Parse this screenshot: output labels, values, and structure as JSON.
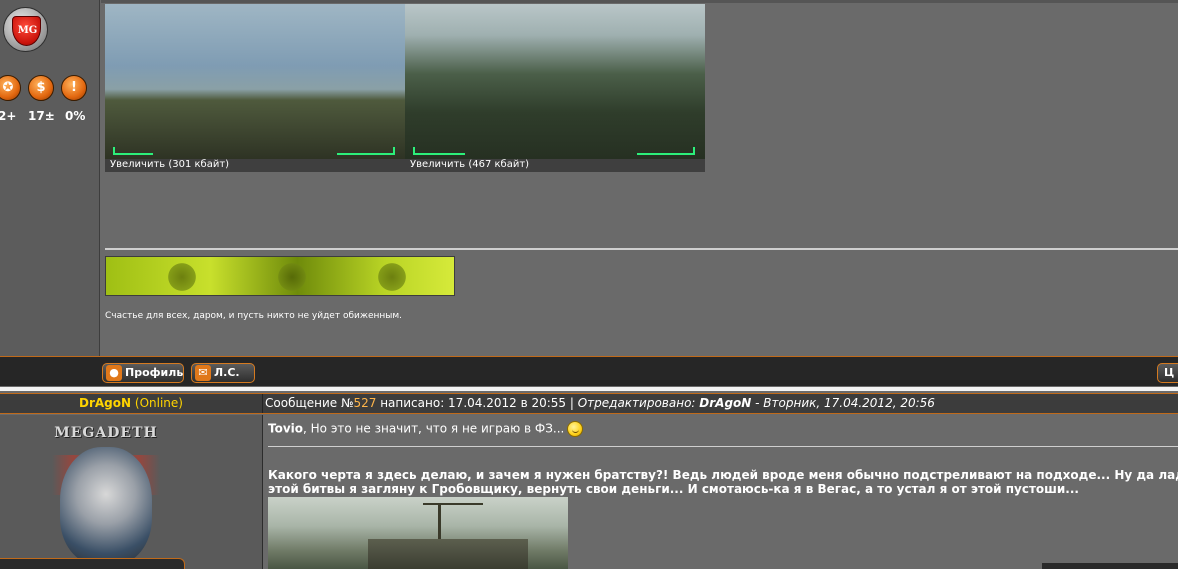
{
  "upper_post": {
    "logo_text": "MG",
    "stats": [
      {
        "icon": "award-icon",
        "glyph": "✪",
        "value": "2+"
      },
      {
        "icon": "rating-icon",
        "glyph": "$",
        "value": "17±"
      },
      {
        "icon": "warning-icon",
        "glyph": "!",
        "value": "0%"
      }
    ],
    "attachments": [
      {
        "caption": "Увеличить (301 кбайт)"
      },
      {
        "caption": "Увеличить (467 кбайт)"
      }
    ],
    "signature": "Счастье для всех, даром, и пусть никто не уйдет обиженным.",
    "buttons": {
      "profile_label": "Профиль",
      "pm_label": "Л.С.",
      "quote_label": "Ц"
    },
    "colors": {
      "accent": "#d57a20",
      "nick": "#ffd400"
    }
  },
  "lower_post": {
    "author": {
      "nick": "DrAgoN",
      "status": "(Online)"
    },
    "header": {
      "prefix": "Сообщение №",
      "number": "527",
      "written": " написано: 17.04.2012 в 20:55 | ",
      "edited_label": "Отредактировано: ",
      "edited_by": "DrAgoN",
      "edited_when": " - Вторник, 17.04.2012, 20:56"
    },
    "avatar_title": "MEGADETH",
    "reply_to": "Tovio",
    "reply_text": ", Но это не значит, что я не играю в ФЗ...",
    "body_lines": [
      "Какого черта я здесь делаю, и зачем я нужен братству?! Ведь людей вроде меня обычно подстреливают на подходе... Ну да ладно,",
      "этой битвы я загляну к Гробовщику, вернуть свои деньги... И смотаюсь-ка я в Вегас, а то устал я от этой пустоши..."
    ]
  }
}
